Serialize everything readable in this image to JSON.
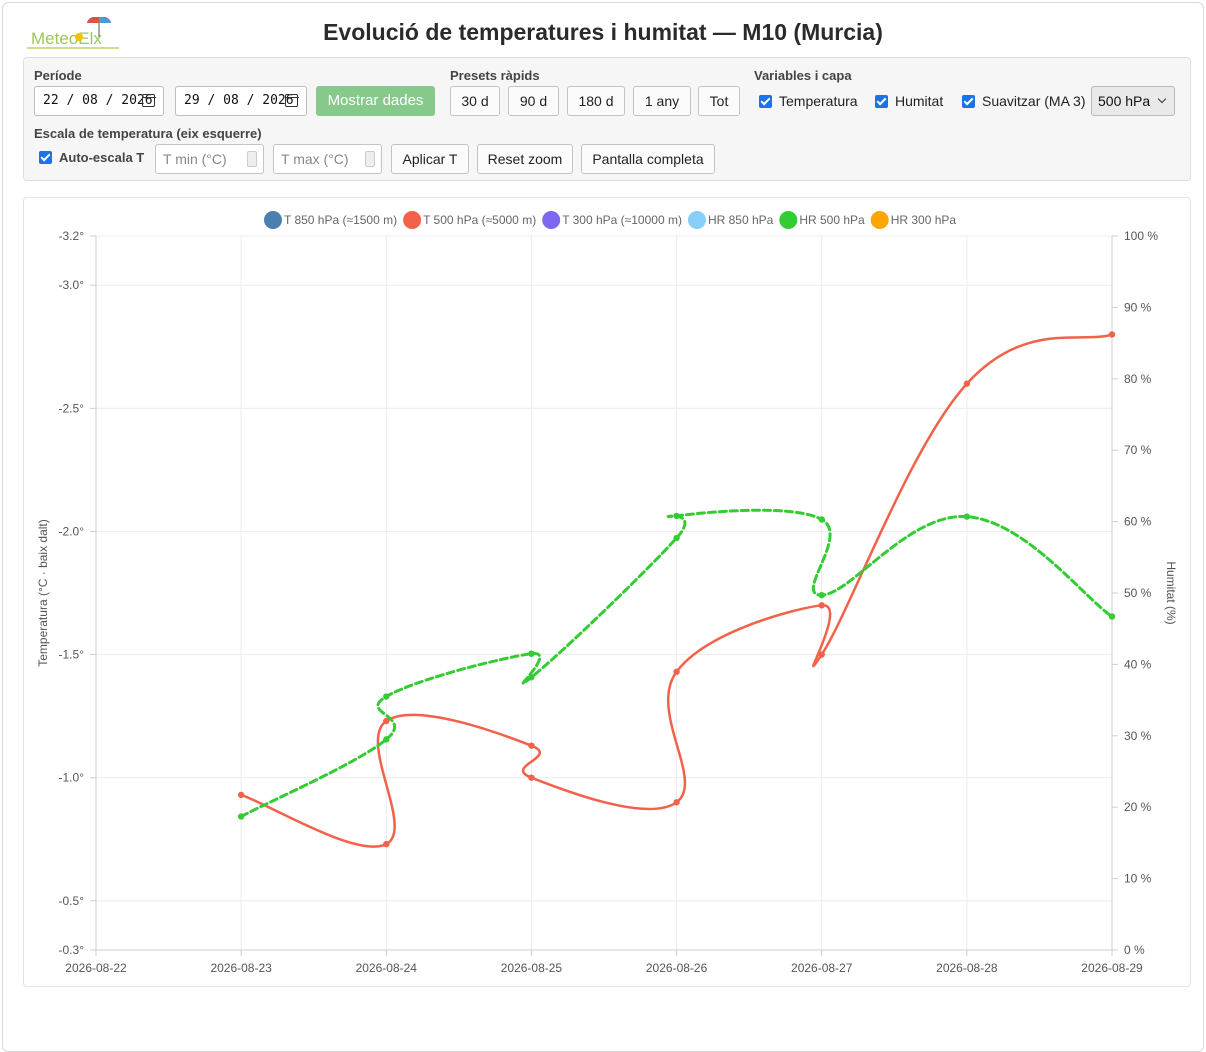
{
  "header": {
    "title": "Evolució de temperatures i humitat — M10 (Murcia)",
    "logo_text": "MeteoElx"
  },
  "controls": {
    "period_label": "Període",
    "date_from": "22 / 08 / 2026",
    "date_to": "29 / 08 / 2026",
    "show_button": "Mostrar dades",
    "presets_label": "Presets ràpids",
    "presets": [
      "30 d",
      "90 d",
      "180 d",
      "1 any",
      "Tot"
    ],
    "variables_label": "Variables i capa",
    "var_temp": "Temperatura",
    "var_hum": "Humitat",
    "var_smooth": "Suavitzar (MA 3)",
    "layer": "500 hPa",
    "scale_label": "Escala de temperatura (eix esquerre)",
    "autoscale": "Auto-escala T",
    "tmin_placeholder": "T min (°C)",
    "tmax_placeholder": "T max (°C)",
    "apply_button": "Aplicar T",
    "reset_button": "Reset zoom",
    "fullscreen_button": "Pantalla completa"
  },
  "chart_data": {
    "type": "line",
    "y_left_label": "Temperatura (°C · baix dalt)",
    "y_right_label": "Humitat (%)",
    "y_left_ticks": [
      "-3.2°",
      "-3.0°",
      "-2.5°",
      "-2.0°",
      "-1.5°",
      "-1.0°",
      "-0.5°",
      "-0.3°"
    ],
    "y_left_range": [
      -3.2,
      -0.3
    ],
    "y_left_reversed": true,
    "y_right_ticks": [
      "100 %",
      "90 %",
      "80 %",
      "70 %",
      "60 %",
      "50 %",
      "40 %",
      "30 %",
      "20 %",
      "10 %",
      "0 %"
    ],
    "y_right_range": [
      0,
      100
    ],
    "x_ticks": [
      "2026-08-22",
      "2026-08-23",
      "2026-08-24",
      "2026-08-25",
      "2026-08-26",
      "2026-08-27",
      "2026-08-28",
      "2026-08-29"
    ],
    "legend": [
      {
        "name": "T 850 hPa (≈1500 m)",
        "color": "#4a7fb0"
      },
      {
        "name": "T 500 hPa (≈5000 m)",
        "color": "#f2614a"
      },
      {
        "name": "T 300 hPa (≈10000 m)",
        "color": "#7b68ee"
      },
      {
        "name": "HR 850 hPa",
        "color": "#87cefa"
      },
      {
        "name": "HR 500 hPa",
        "color": "#33cc33"
      },
      {
        "name": "HR 300 hPa",
        "color": "#ffa500"
      }
    ],
    "series": [
      {
        "name": "T 500 hPa (≈5000 m)",
        "color": "#f2614a",
        "axis": "left",
        "dash": false,
        "points": [
          [
            "2026-08-23 00:00",
            -0.93
          ],
          [
            "2026-08-24 00:00",
            -0.73
          ],
          [
            "2026-08-24 00:00",
            -1.23
          ],
          [
            "2026-08-25 00:00",
            -1.13
          ],
          [
            "2026-08-25 00:00",
            -1.0
          ],
          [
            "2026-08-26 00:00",
            -0.9
          ],
          [
            "2026-08-26 00:00",
            -1.43
          ],
          [
            "2026-08-27 00:00",
            -1.7
          ],
          [
            "2026-08-27 00:00",
            -1.5
          ],
          [
            "2026-08-28 00:00",
            -2.6
          ],
          [
            "2026-08-29 00:00",
            -2.8
          ]
        ]
      },
      {
        "name": "HR 500 hPa",
        "color": "#33cc33",
        "axis": "right",
        "dash": true,
        "points": [
          [
            "2026-08-23 00:00",
            18.7
          ],
          [
            "2026-08-24 00:00",
            29.5
          ],
          [
            "2026-08-24 00:00",
            35.5
          ],
          [
            "2026-08-25 00:00",
            41.5
          ],
          [
            "2026-08-25 00:00",
            38.2
          ],
          [
            "2026-08-26 00:00",
            57.7
          ],
          [
            "2026-08-26 00:00",
            60.8
          ],
          [
            "2026-08-27 00:00",
            60.3
          ],
          [
            "2026-08-27 00:00",
            49.7
          ],
          [
            "2026-08-28 00:00",
            60.7
          ],
          [
            "2026-08-29 00:00",
            46.7
          ]
        ]
      }
    ]
  }
}
